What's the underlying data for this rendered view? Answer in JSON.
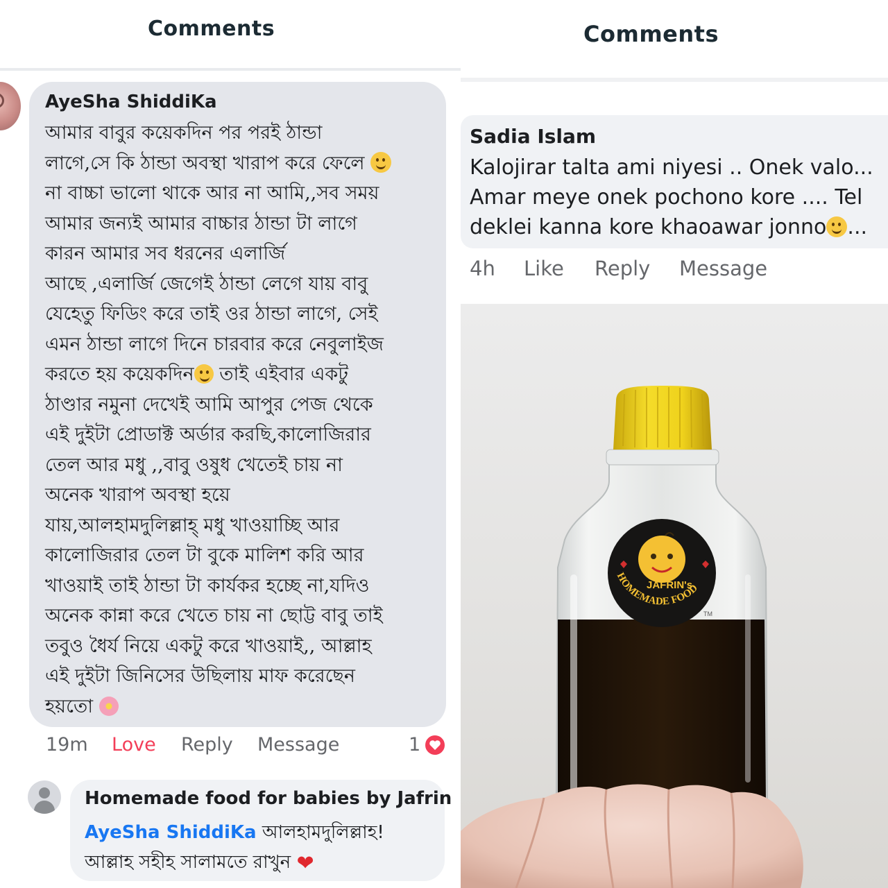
{
  "left": {
    "header_title": "Comments",
    "comment": {
      "author": "AyeSha ShiddiKa",
      "lines": [
        "আমার বাবুর কয়েকদিন পর পরই ঠান্ডা",
        "লাগে,সে কি ঠান্ডা অবস্থা খারাপ করে ফেলে",
        "না বাচ্চা ভালো থাকে আর না আমি,,সব সময়",
        "আমার জন্যই আমার বাচ্চার ঠান্ডা টা লাগে",
        "কারন আমার সব ধরনের এলার্জি",
        "আছে ,এলার্জি জেগেই ঠান্ডা লেগে যায় বাবু",
        "যেহেতু ফিডিং করে তাই ওর ঠান্ডা লাগে, সেই",
        "এমন ঠান্ডা লাগে দিনে চারবার করে নেবুলাইজ",
        "করতে হয় কয়েকদিন",
        " তাই এইবার একটু",
        "ঠাণ্ডার নমুনা দেখেই আমি আপুর পেজ থেকে",
        "এই দুইটা প্রোডাক্ট অর্ডার করছি,কালোজিরার",
        "তেল আর মধু ,,বাবু ওষুধ খেতেই চায় না",
        "অনেক খারাপ অবস্থা হয়ে",
        "যায়,আলহামদুলিল্লাহ্ মধু খাওয়াচ্ছি আর",
        "কালোজিরার তেল টা বুকে মালিশ করি আর",
        "খাওয়াই তাই ঠান্ডা টা কার্যকর হচ্ছে না,যদিও",
        "অনেক কান্না করে খেতে চায় না ছোট্ট বাবু তাই",
        "তবুও ধৈর্য নিয়ে একটু করে খাওয়াই,, আল্লাহ",
        "এই দুইটা জিনিসের উছিলায় মাফ করেছেন",
        "হয়তো"
      ],
      "time": "19m",
      "reaction_label": "Love",
      "reply_label": "Reply",
      "message_label": "Message",
      "reaction_count": "1"
    },
    "reply": {
      "author": "Homemade food for babies by Jafrin",
      "mention": "AyeSha ShiddiKa",
      "line1_rest": " আলহামদুলিল্লাহ!",
      "line2": "আল্লাহ সহীহ সালামতে রাখুন"
    }
  },
  "right": {
    "header_title": "Comments",
    "comment": {
      "author": "Sadia Islam",
      "lines": [
        "Kalojirar talta ami niyesi .. Onek valo...",
        "Amar meye onek pochono kore .... Tel",
        "deklei kanna kore khaoawar jonno",
        "..."
      ],
      "time": "4h",
      "like_label": "Like",
      "reply_label": "Reply",
      "message_label": "Message"
    },
    "photo": {
      "label_brand": "JAFRIN's",
      "label_arc": "HOMEMADE FOOD",
      "tm": "TM"
    }
  },
  "colors": {
    "love": "#f33e58",
    "mention": "#1877f2",
    "bubble": "#e4e6eb",
    "meta_text": "#65676b",
    "cap_yellow": "#f2d21a"
  }
}
